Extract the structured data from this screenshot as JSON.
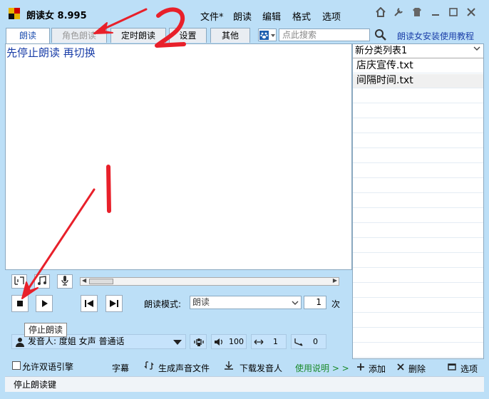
{
  "app": {
    "title": "朗读女 8.995"
  },
  "menu": [
    "文件*",
    "朗读",
    "编辑",
    "格式",
    "选项"
  ],
  "tabs": [
    {
      "label": "朗读"
    },
    {
      "label": "角色朗读"
    },
    {
      "label": "定时朗读"
    },
    {
      "label": "设置"
    },
    {
      "label": "其他"
    }
  ],
  "search": {
    "placeholder": "点此搜索"
  },
  "help_link": "朗读女安装使用教程",
  "editor": {
    "text": "先停止朗读 再切换"
  },
  "controls": {
    "mode_label": "朗读模式:",
    "mode_value": "朗读",
    "repeat_count": "1",
    "repeat_unit": "次",
    "tooltip": "停止朗读",
    "voice": "发音人: 度姐 女声 普通话",
    "volume": "100",
    "speed": "1",
    "pitch": "0",
    "bilingual_label": "允许双语引擎",
    "subtitle_label": "字幕",
    "generate_audio_label": "生成声音文件",
    "download_voice_label": "下载发音人",
    "instructions_label": "使用说明 > >"
  },
  "filelist": {
    "header": "新分类列表1",
    "items": [
      "店庆宣传.txt",
      "间隔时间.txt"
    ],
    "add_label": "添加",
    "delete_label": "删除",
    "options_label": "选项"
  },
  "status": "停止朗读键",
  "annotations": [
    "1",
    "2"
  ],
  "colors": {
    "accent": "#1a3ea8",
    "background": "#bcdff7",
    "annotation": "#e8202a"
  }
}
